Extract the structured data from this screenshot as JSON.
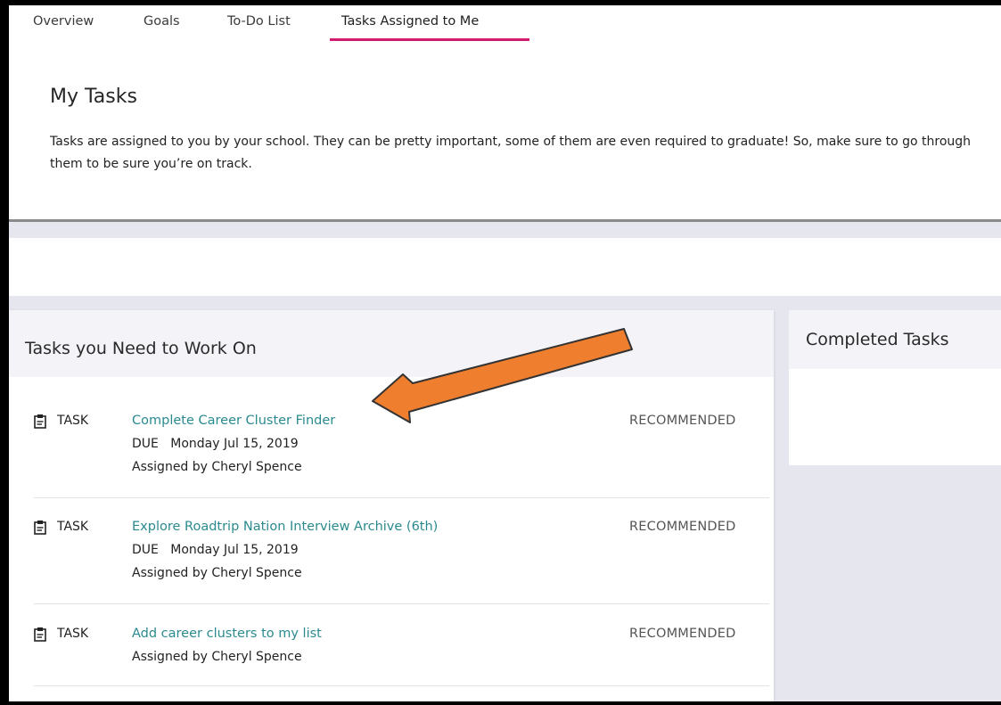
{
  "tabs": [
    {
      "label": "Overview"
    },
    {
      "label": "Goals"
    },
    {
      "label": "To-Do List"
    },
    {
      "label": "Tasks Assigned to Me"
    }
  ],
  "hero": {
    "title": "My Tasks",
    "text": "Tasks are assigned to you by your school. They can be pretty important, some of them are even required to graduate! So, make sure to go through them to be sure you’re on track."
  },
  "work_on": {
    "title": "Tasks you Need to Work On",
    "tasks": [
      {
        "type": "TASK",
        "title": "Complete Career Cluster Finder",
        "due_label": "DUE",
        "due_date": "Monday Jul 15, 2019",
        "assigned": "Assigned by Cheryl Spence",
        "status": "RECOMMENDED"
      },
      {
        "type": "TASK",
        "title": "Explore Roadtrip Nation Interview Archive (6th)",
        "due_label": "DUE",
        "due_date": "Monday Jul 15, 2019",
        "assigned": "Assigned by Cheryl Spence",
        "status": "RECOMMENDED"
      },
      {
        "type": "TASK",
        "title": "Add career clusters to my list",
        "assigned": "Assigned by Cheryl Spence",
        "status": "RECOMMENDED"
      }
    ]
  },
  "completed": {
    "title": "Completed Tasks"
  },
  "colors": {
    "accent": "#d21a6f",
    "link": "#2b8a8f",
    "arrow": "#ef7f2f"
  },
  "icons": {
    "task": "clipboard-icon",
    "annotation": "arrow-annotation"
  }
}
